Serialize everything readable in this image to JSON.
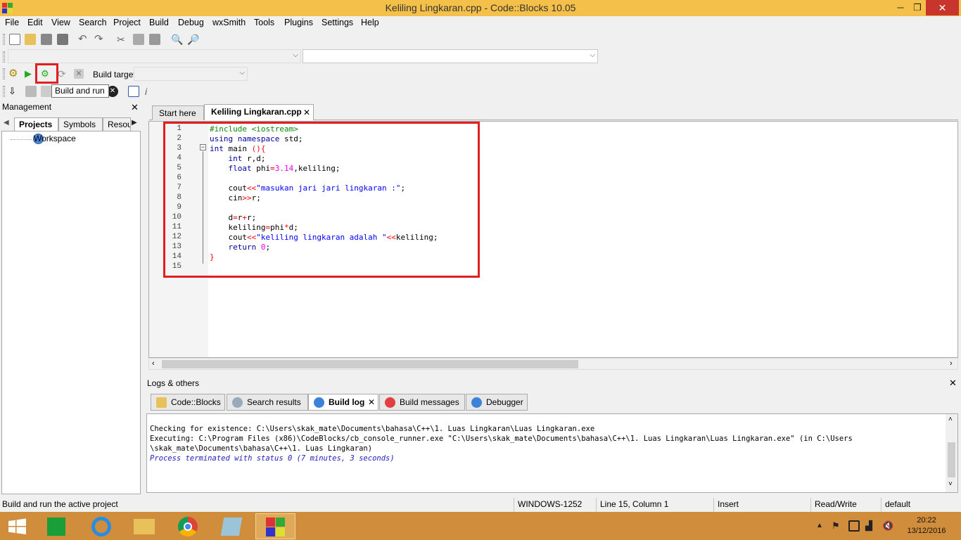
{
  "window": {
    "title": "Keliling Lingkaran.cpp - Code::Blocks 10.05",
    "minimize": "─",
    "restore": "❐",
    "close": "✕"
  },
  "menu": [
    "File",
    "Edit",
    "View",
    "Search",
    "Project",
    "Build",
    "Debug",
    "wxSmith",
    "Tools",
    "Plugins",
    "Settings",
    "Help"
  ],
  "toolbar": {
    "build_target_label": "Build target:",
    "tooltip": "Build and run"
  },
  "management": {
    "title": "Management",
    "tabs": [
      "Projects",
      "Symbols",
      "Resou"
    ],
    "tree_root": "Workspace"
  },
  "editor": {
    "tabs": [
      {
        "label": "Start here"
      },
      {
        "label": "Keliling Lingkaran.cpp"
      }
    ],
    "line_numbers": [
      "1",
      "2",
      "3",
      "4",
      "5",
      "6",
      "7",
      "8",
      "9",
      "10",
      "11",
      "12",
      "13",
      "14",
      "15"
    ]
  },
  "logs": {
    "title": "Logs & others",
    "tabs": [
      "Code::Blocks",
      "Search results",
      "Build log",
      "Build messages",
      "Debugger"
    ],
    "lines": [
      "Checking for existence: C:\\Users\\skak_mate\\Documents\\bahasa\\C++\\1. Luas Lingkaran\\Luas Lingkaran.exe",
      "Executing: C:\\Program Files (x86)\\CodeBlocks/cb_console_runner.exe \"C:\\Users\\skak_mate\\Documents\\bahasa\\C++\\1. Luas Lingkaran\\Luas Lingkaran.exe\" (in C:\\Users",
      "\\skak_mate\\Documents\\bahasa\\C++\\1. Luas Lingkaran)",
      "Process terminated with status 0 (7 minutes, 3 seconds)"
    ]
  },
  "status": {
    "message": "Build and run the active project",
    "encoding": "WINDOWS-1252",
    "position": "Line 15, Column 1",
    "mode": "Insert",
    "access": "Read/Write",
    "lang": "default"
  },
  "clock": {
    "time": "20:22",
    "date": "13/12/2016"
  },
  "colors": {
    "highlight": "#e02020",
    "titlebar": "#f5c04a",
    "taskbar": "#d08e3c"
  }
}
